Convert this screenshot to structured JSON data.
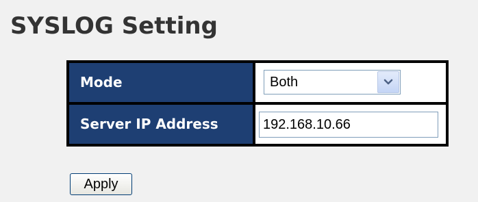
{
  "page": {
    "title": "SYSLOG Setting"
  },
  "settings": {
    "mode": {
      "label": "Mode",
      "selected": "Both"
    },
    "server_ip": {
      "label": "Server IP Address",
      "value": "192.168.10.66"
    }
  },
  "actions": {
    "apply_label": "Apply"
  },
  "icons": {
    "select_arrow": "chevron-down-icon"
  },
  "colors": {
    "label_bg": "#1e3f73",
    "table_border": "#000000",
    "page_bg": "#f1f1f1",
    "title_text": "#333333"
  }
}
